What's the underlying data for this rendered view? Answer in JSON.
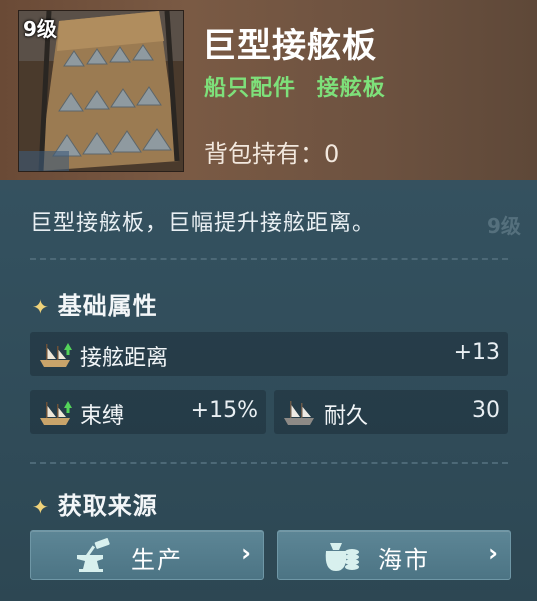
{
  "item": {
    "level": "9级",
    "title": "巨型接舷板",
    "tags": [
      "船只配件",
      "接舷板"
    ],
    "owned_label": "背包持有：",
    "owned_value": "0",
    "description": "巨型接舷板，巨幅提升接舷距离。",
    "ghost_level": "9级"
  },
  "base_attributes": {
    "title": "基础属性",
    "rows": [
      {
        "label": "接舷距离",
        "value": "+13",
        "icon": "ship-upgrade-icon"
      },
      {
        "label": "束缚",
        "value": "+15%",
        "icon": "ship-upgrade-icon"
      },
      {
        "label": "耐久",
        "value": "30",
        "icon": "ship-icon"
      }
    ]
  },
  "sources": {
    "title": "获取来源",
    "buttons": [
      {
        "label": "生产",
        "icon": "anvil-hammer-icon"
      },
      {
        "label": "海市",
        "icon": "coins-bag-icon"
      }
    ],
    "chevron": "›"
  },
  "colors": {
    "tag_green": "#7ee07a",
    "button_bg": "#5d8696",
    "upgrade_arrow": "#53d35a"
  }
}
